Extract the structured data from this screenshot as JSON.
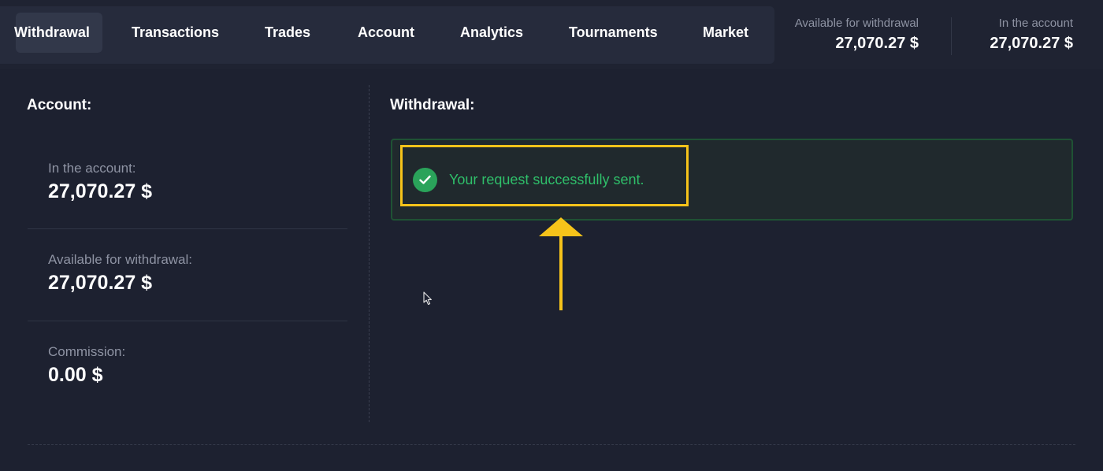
{
  "nav": {
    "tabs": [
      {
        "label": "Withdrawal",
        "active": true
      },
      {
        "label": "Transactions",
        "active": false
      },
      {
        "label": "Trades",
        "active": false
      },
      {
        "label": "Account",
        "active": false
      },
      {
        "label": "Analytics",
        "active": false
      },
      {
        "label": "Tournaments",
        "active": false
      },
      {
        "label": "Market",
        "active": false
      }
    ]
  },
  "header_balances": {
    "available": {
      "label": "Available for withdrawal",
      "value": "27,070.27 $"
    },
    "in_account": {
      "label": "In the account",
      "value": "27,070.27 $"
    }
  },
  "account": {
    "title": "Account:",
    "in_account": {
      "label": "In the account:",
      "value": "27,070.27 $"
    },
    "available": {
      "label": "Available for withdrawal:",
      "value": "27,070.27 $"
    },
    "commission": {
      "label": "Commission:",
      "value": "0.00 $"
    }
  },
  "withdrawal": {
    "title": "Withdrawal:",
    "success_message": "Your request successfully sent.",
    "success_icon": "check-circle-icon"
  },
  "colors": {
    "background": "#1d2130",
    "tab_bar": "#262b3c",
    "success_green": "#2fbf6a",
    "highlight_yellow": "#f6c31a"
  }
}
